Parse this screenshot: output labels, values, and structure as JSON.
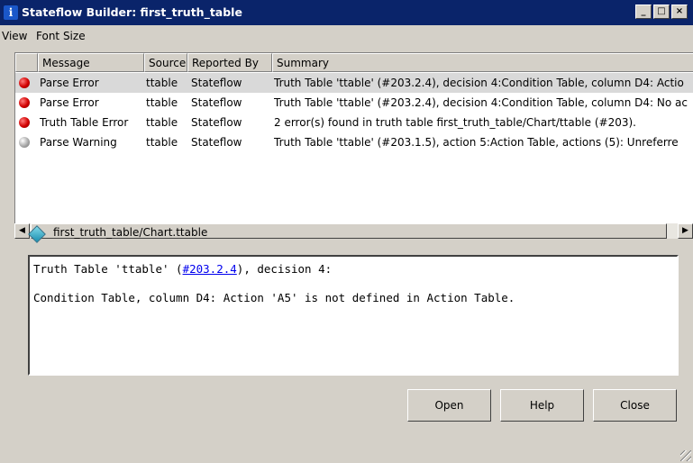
{
  "window": {
    "title": "Stateflow Builder: first_truth_table",
    "icon": "info-icon",
    "controls": [
      "minimize",
      "maximize",
      "close"
    ]
  },
  "menu": [
    "View",
    "Font Size"
  ],
  "table": {
    "columns": [
      "Message",
      "Source",
      "Reported By",
      "Summary"
    ],
    "rows": [
      {
        "status": "red",
        "message": "Parse Error",
        "source": "ttable",
        "reported_by": "Stateflow",
        "summary": "Truth Table 'ttable' (#203.2.4), decision 4:Condition Table, column D4: Actio",
        "selected": true
      },
      {
        "status": "red",
        "message": "Parse Error",
        "source": "ttable",
        "reported_by": "Stateflow",
        "summary": "Truth Table 'ttable' (#203.2.4), decision 4:Condition Table, column D4: No ac",
        "selected": false
      },
      {
        "status": "red",
        "message": "Truth Table Error",
        "source": "ttable",
        "reported_by": "Stateflow",
        "summary": "2 error(s) found in truth table first_truth_table/Chart/ttable (#203).",
        "selected": false
      },
      {
        "status": "gray",
        "message": "Parse Warning",
        "source": "ttable",
        "reported_by": "Stateflow",
        "summary": "Truth Table 'ttable' (#203.1.5), action 5:Action Table, actions (5): Unreferre",
        "selected": false
      }
    ]
  },
  "path": "first_truth_table/Chart.ttable",
  "detail": {
    "line1_pre": "Truth Table 'ttable' (",
    "line1_link": "#203.2.4",
    "line1_post": "), decision 4:",
    "line2": "Condition Table, column D4: Action 'A5' is not defined in Action Table."
  },
  "buttons": {
    "open": "Open",
    "help": "Help",
    "close": "Close"
  },
  "colors": {
    "titlebar": "#0a246a",
    "error": "#d10000",
    "warning": "#a8a8a8",
    "link": "#0000ee"
  }
}
